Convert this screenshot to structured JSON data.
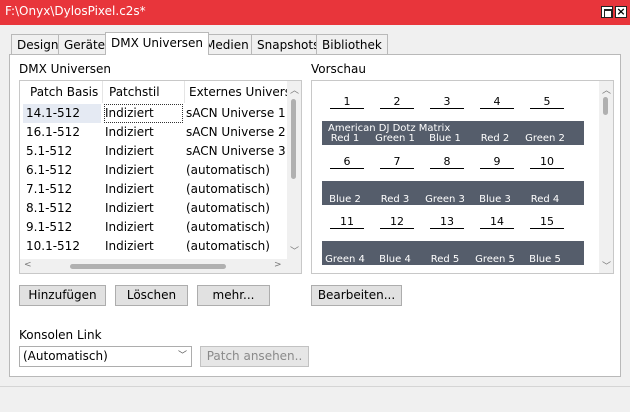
{
  "window": {
    "title": "F:\\Onyx\\DylosPixel.c2s*"
  },
  "tabs": [
    {
      "label": "Design"
    },
    {
      "label": "Geräte"
    },
    {
      "label": "DMX Universen"
    },
    {
      "label": "Medien"
    },
    {
      "label": "Snapshots"
    },
    {
      "label": "Bibliothek"
    }
  ],
  "dmx_section": {
    "title": "DMX Universen",
    "columns": [
      "Patch Basis",
      "Patchstil",
      "Externes Universu"
    ],
    "rows": [
      {
        "basis": "14.1-512",
        "stil": "Indiziert",
        "extern": "sACN Universe 1"
      },
      {
        "basis": "16.1-512",
        "stil": "Indiziert",
        "extern": "sACN Universe 2"
      },
      {
        "basis": "5.1-512",
        "stil": "Indiziert",
        "extern": "sACN Universe 3"
      },
      {
        "basis": "6.1-512",
        "stil": "Indiziert",
        "extern": "(automatisch)"
      },
      {
        "basis": "7.1-512",
        "stil": "Indiziert",
        "extern": "(automatisch)"
      },
      {
        "basis": "8.1-512",
        "stil": "Indiziert",
        "extern": "(automatisch)"
      },
      {
        "basis": "9.1-512",
        "stil": "Indiziert",
        "extern": "(automatisch)"
      },
      {
        "basis": "10.1-512",
        "stil": "Indiziert",
        "extern": "(automatisch)"
      }
    ],
    "selected_row": 0,
    "buttons": {
      "add": "Hinzufügen",
      "delete": "Löschen",
      "more": "mehr..."
    }
  },
  "preview": {
    "title": "Vorschau",
    "numbers": [
      [
        "1",
        "2",
        "3",
        "4",
        "5"
      ],
      [
        "6",
        "7",
        "8",
        "9",
        "10"
      ],
      [
        "11",
        "12",
        "13",
        "14",
        "15"
      ]
    ],
    "fixture_title": "American DJ Dotz Matrix",
    "labels": [
      [
        "Red 1",
        "Green 1",
        "Blue 1",
        "Red 2",
        "Green 2"
      ],
      [
        "Blue 2",
        "Red 3",
        "Green 3",
        "Blue 3",
        "Red 4"
      ],
      [
        "Green 4",
        "Blue 4",
        "Red 5",
        "Green 5",
        "Blue 5"
      ]
    ],
    "edit_button": "Bearbeiten..."
  },
  "console": {
    "label": "Konsolen Link",
    "selected": "(Automatisch)",
    "view_patch_button": "Patch ansehen.."
  }
}
